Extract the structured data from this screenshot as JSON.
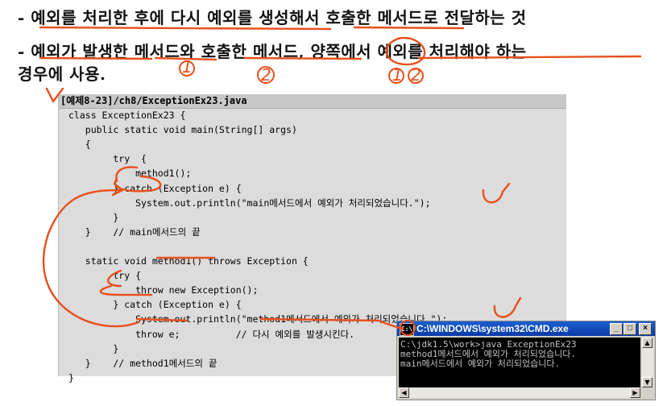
{
  "bullets": [
    "- 예외를 처리한 후에 다시 예외를 생성해서 호출한 메서드로 전달하는 것",
    "- 예외가 발생한 메서드와 호출한 메서드, 양쪽에서 예외를 처리해야 하는",
    "경우에 사용."
  ],
  "code": {
    "header_tag": "[예제8-23]",
    "header_path": "/ch8/ExceptionEx23.java",
    "lines": [
      "class ExceptionEx23 {",
      "   public static void main(String[] args)",
      "   {",
      "        try  {",
      "            method1();",
      "        } catch (Exception e) {",
      "            System.out.println(\"main메서드에서 예외가 처리되었습니다.\");",
      "        }",
      "   }    // main메서드의 끝",
      "",
      "   static void method1() throws Exception {",
      "        try {",
      "            throw new Exception();",
      "        } catch (Exception e) {",
      "            System.out.println(\"method1메서드에서 예외가 처리되었습니다.\");",
      "            throw e;          // 다시 예외를 발생시킨다.",
      "        }",
      "   }    // method1메서드의 끝",
      "}"
    ]
  },
  "cmd": {
    "title": "C:\\WINDOWS\\system32\\CMD.exe",
    "icon_label": "C:\\",
    "lines": [
      "C:\\jdk1.5\\work>java ExceptionEx23",
      "method1메서드에서 예외가 처리되었습니다.",
      "main메서드에서 예외가 처리되었습니다."
    ],
    "buttons": [
      "_",
      "□",
      "×"
    ]
  },
  "annotations": {
    "ink_color": "#e8501c",
    "marks": [
      "1",
      "2",
      "1",
      "2"
    ]
  }
}
